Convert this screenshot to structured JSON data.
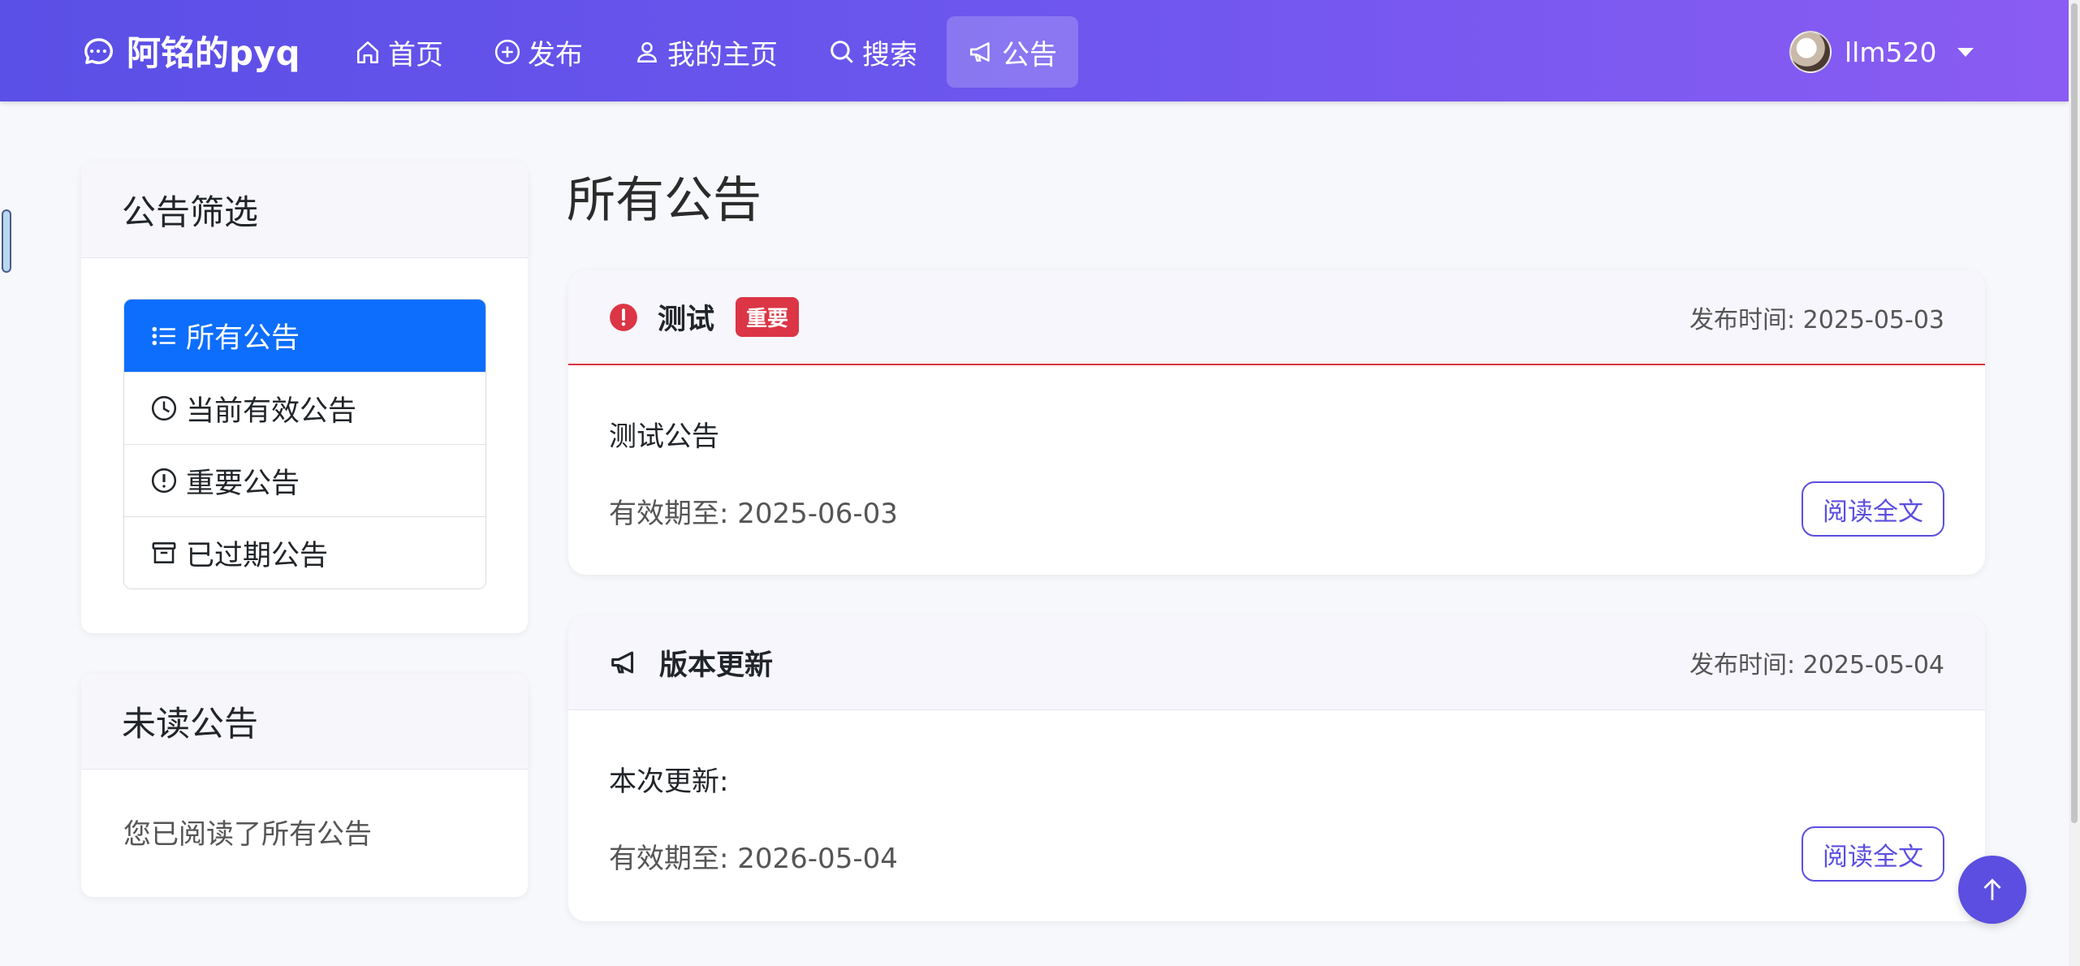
{
  "brand": {
    "title": "阿铭的pyq"
  },
  "nav": {
    "items": [
      {
        "label": "首页",
        "icon": "house-icon"
      },
      {
        "label": "发布",
        "icon": "plus-circle-icon"
      },
      {
        "label": "我的主页",
        "icon": "person-icon"
      },
      {
        "label": "搜索",
        "icon": "search-icon"
      },
      {
        "label": "公告",
        "icon": "megaphone-icon",
        "active": true
      }
    ]
  },
  "user": {
    "name": "llm520"
  },
  "sidebar": {
    "filter_title": "公告筛选",
    "filters": [
      {
        "label": "所有公告",
        "icon": "list-icon",
        "active": true
      },
      {
        "label": "当前有效公告",
        "icon": "clock-icon"
      },
      {
        "label": "重要公告",
        "icon": "exclamation-circle-icon"
      },
      {
        "label": "已过期公告",
        "icon": "archive-icon"
      }
    ],
    "unread_title": "未读公告",
    "unread_text": "您已阅读了所有公告"
  },
  "main": {
    "title": "所有公告",
    "announcements": [
      {
        "title": "测试",
        "badge": "重要",
        "time": "发布时间: 2025-05-03",
        "content": "测试公告",
        "expire": "有效期至: 2025-06-03",
        "read_label": "阅读全文",
        "icon": "exclamation-circle-fill-icon"
      },
      {
        "title": "版本更新",
        "time": "发布时间: 2025-05-04",
        "content": "本次更新:",
        "expire": "有效期至: 2026-05-04",
        "read_label": "阅读全文",
        "icon": "megaphone-icon"
      }
    ]
  },
  "colors": {
    "primary": "#0d6efd",
    "accent": "#5b4ee0",
    "danger": "#dc3545"
  }
}
